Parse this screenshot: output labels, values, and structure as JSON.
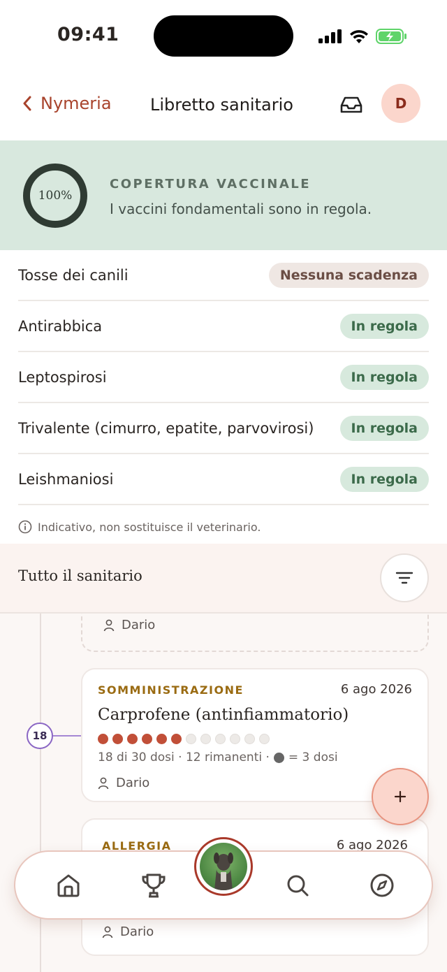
{
  "status_bar": {
    "time": "09:41"
  },
  "nav": {
    "back_label": "Nymeria",
    "title": "Libretto sanitario",
    "avatar_initial": "D"
  },
  "coverage": {
    "percent": "100%",
    "percent_value": 100,
    "title": "COPERTURA VACCINALE",
    "subtitle": "I vaccini fondamentali sono in regola."
  },
  "vaccines": [
    {
      "name": "Tosse dei canili",
      "status": "Nessuna scadenza"
    },
    {
      "name": "Antirabbica",
      "status": "In regola"
    },
    {
      "name": "Leptospirosi",
      "status": "In regola"
    },
    {
      "name": "Trivalente (cimurro, epatite, parvovirosi)",
      "status": "In regola"
    },
    {
      "name": "Leishmaniosi",
      "status": "In regola"
    }
  ],
  "disclaimer": "Indicativo, non sostituisce il veterinario.",
  "section": {
    "title": "Tutto il sanitario"
  },
  "timeline": {
    "previous_card": {
      "person": "Dario"
    },
    "day_badge": "18",
    "cards": [
      {
        "kind": "SOMMINISTRAZIONE",
        "date": "6 ago 2026",
        "title": "Carprofene (antinfiammatorio)",
        "doses_total": 12,
        "doses_filled": 6,
        "dose_text_before": "18 di 30 dosi · 12 rimanenti ·",
        "dose_text_after": "= 3 dosi",
        "person": "Dario"
      },
      {
        "kind": "ALLERGIA",
        "date": "6 ago 2026",
        "person": "Dario"
      }
    ]
  },
  "colors": {
    "accent": "#a8432c",
    "ok_bg": "#d7e9dd",
    "coverage_bg": "#d8e8de",
    "dose_filled": "#c14f38"
  }
}
